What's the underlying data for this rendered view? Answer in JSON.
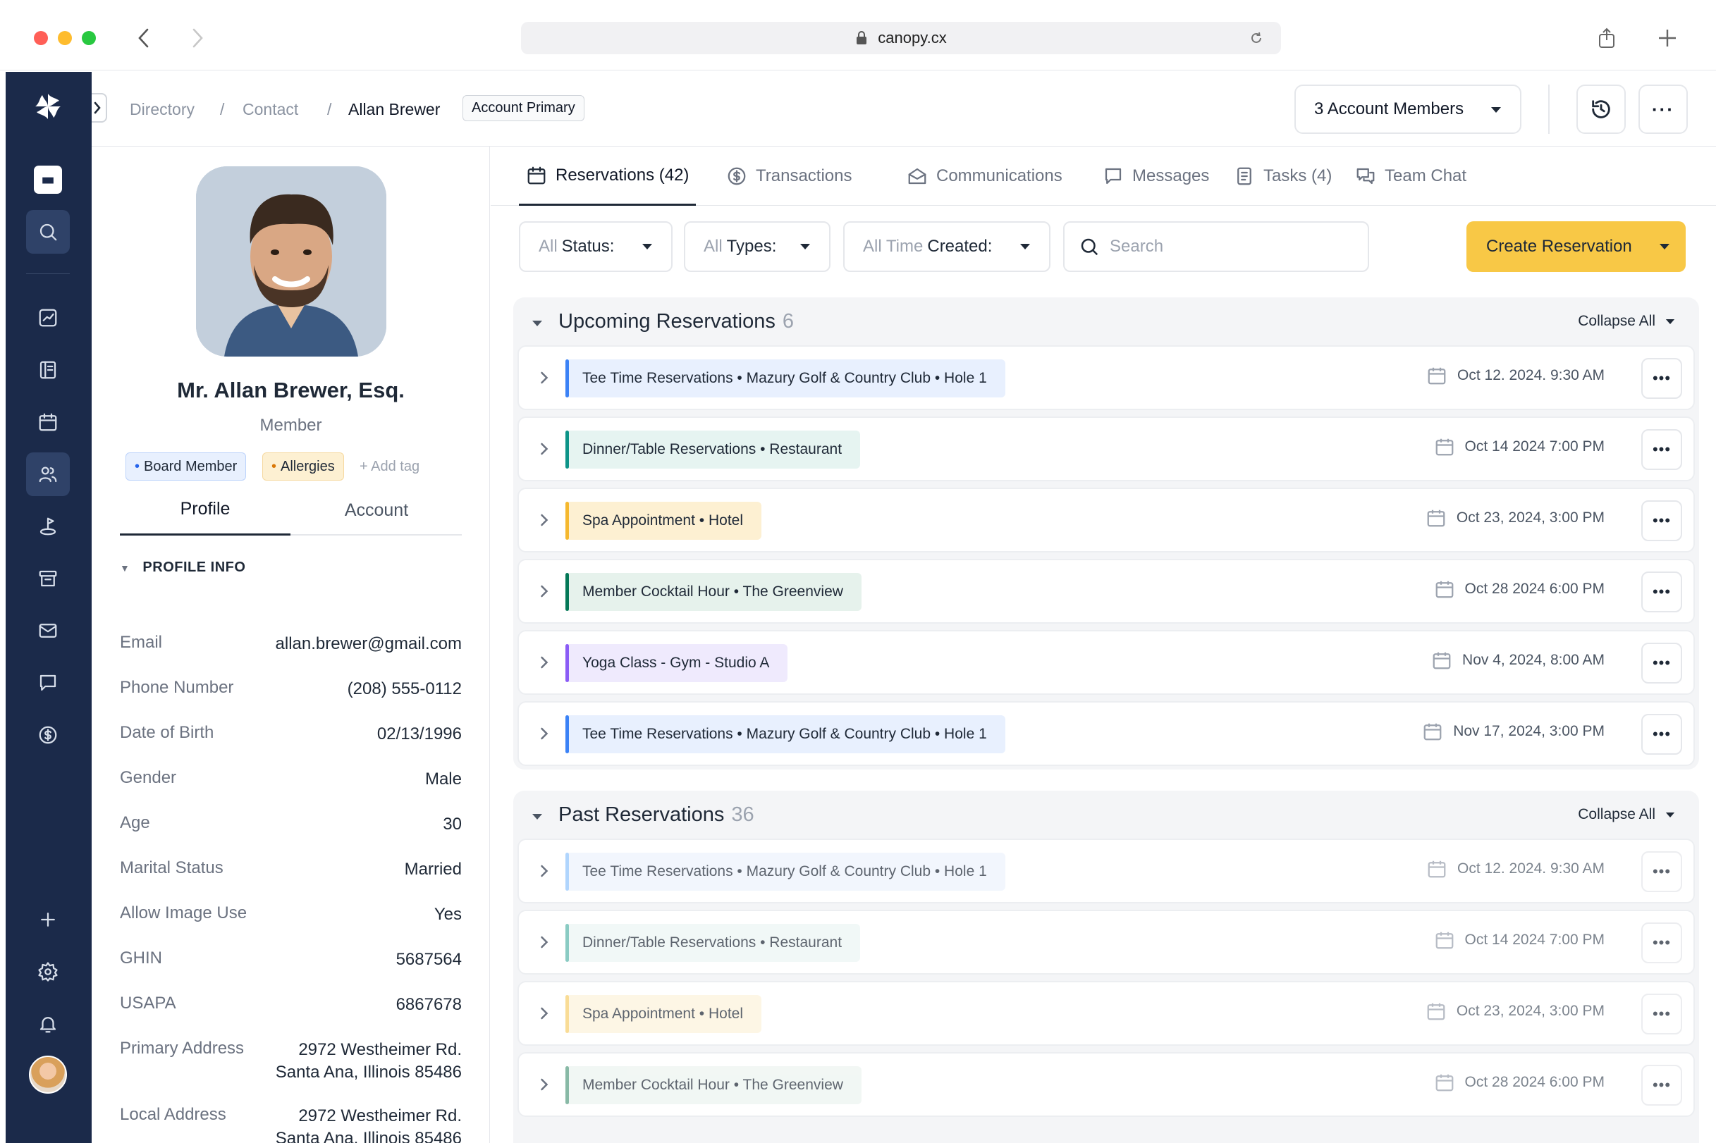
{
  "browser": {
    "url": "canopy.cx"
  },
  "breadcrumb": {
    "items": [
      "Directory",
      "Contact"
    ],
    "current": "Allan Brewer",
    "badge": "Account Primary"
  },
  "header": {
    "members_label": "3 Account Members"
  },
  "profile": {
    "name": "Mr. Allan Brewer, Esq.",
    "role": "Member",
    "tags": [
      {
        "label": "Board Member",
        "color": "#2563eb"
      },
      {
        "label": "Allergies",
        "color": "#d97706"
      }
    ],
    "add_tag": "+ Add tag",
    "tabs": [
      "Profile",
      "Account"
    ],
    "section_title": "PROFILE INFO",
    "fields": [
      {
        "label": "Email",
        "value": "allan.brewer@gmail.com"
      },
      {
        "label": "Phone Number",
        "value": "(208) 555-0112"
      },
      {
        "label": "Date of Birth",
        "value": "02/13/1996"
      },
      {
        "label": "Gender",
        "value": "Male"
      },
      {
        "label": "Age",
        "value": "30"
      },
      {
        "label": "Marital Status",
        "value": "Married"
      },
      {
        "label": "Allow Image Use",
        "value": "Yes"
      },
      {
        "label": "GHIN",
        "value": "5687564"
      },
      {
        "label": "USAPA",
        "value": "6867678"
      },
      {
        "label": "Primary Address",
        "value": "2972 Westheimer Rd.",
        "value2": "Santa Ana, Illinois 85486"
      },
      {
        "label": "Local Address",
        "value": "2972 Westheimer Rd.",
        "value2": "Santa Ana, Illinois 85486"
      }
    ]
  },
  "tabs": [
    {
      "label": "Reservations (42)",
      "icon": "calendar-icon"
    },
    {
      "label": "Transactions",
      "icon": "dollar-circle-icon"
    },
    {
      "label": "Communications",
      "icon": "envelope-open-icon"
    },
    {
      "label": "Messages",
      "icon": "chat-bubble-icon"
    },
    {
      "label": "Tasks (4)",
      "icon": "clipboard-icon"
    },
    {
      "label": "Team Chat",
      "icon": "team-chat-icon"
    }
  ],
  "filters": {
    "status": {
      "muted": "All",
      "label": "Status:"
    },
    "types": {
      "muted": "All",
      "label": "Types:"
    },
    "time": {
      "muted": "All Time",
      "label": "Created:"
    },
    "search_placeholder": "Search",
    "create_label": "Create Reservation"
  },
  "upcoming": {
    "title": "Upcoming Reservations",
    "count": "6",
    "collapse_label": "Collapse All",
    "rows": [
      {
        "title": "Tee Time Reservations  •  Mazury Golf & Country Club  •  Hole 1",
        "date": "Oct 12. 2024. 9:30 AM",
        "bar": "#3b82f6",
        "bg": "#e8f0fe"
      },
      {
        "title": "Dinner/Table Reservations  •  Restaurant",
        "date": "Oct 14 2024 7:00 PM",
        "bar": "#0d9488",
        "bg": "#e6f4f1"
      },
      {
        "title": "Spa Appointment • Hotel",
        "date": "Oct 23, 2024, 3:00 PM",
        "bar": "#f5b82e",
        "bg": "#fdf0d2"
      },
      {
        "title": "Member Cocktail Hour  •  The Greenview",
        "date": "Oct 28 2024 6:00 PM",
        "bar": "#047857",
        "bg": "#e6f2ec"
      },
      {
        "title": "Yoga Class - Gym - Studio A",
        "date": "Nov 4, 2024, 8:00 AM",
        "bar": "#8b5cf6",
        "bg": "#efeafd"
      },
      {
        "title": "Tee Time Reservations  •  Mazury Golf & Country Club  •  Hole 1",
        "date": "Nov 17, 2024, 3:00 PM",
        "bar": "#3b82f6",
        "bg": "#e8f0fe"
      }
    ]
  },
  "past": {
    "title": "Past Reservations",
    "count": "36",
    "collapse_label": "Collapse All",
    "rows": [
      {
        "title": "Tee Time Reservations  •  Mazury Golf & Country Club  •  Hole 1",
        "date": "Oct 12. 2024. 9:30 AM",
        "bar": "#93c5fd",
        "bg": "#eef3fd"
      },
      {
        "title": "Dinner/Table Reservations  •  Restaurant",
        "date": "Oct 14 2024 7:00 PM",
        "bar": "#5eb8ad",
        "bg": "#edf6f4"
      },
      {
        "title": "Spa Appointment • Hotel",
        "date": "Oct 23, 2024, 3:00 PM",
        "bar": "#f7cf6e",
        "bg": "#fdf3dc"
      },
      {
        "title": "Member Cocktail Hour  •  The Greenview",
        "date": "Oct 28 2024 6:00 PM",
        "bar": "#5b9f84",
        "bg": "#edf4f0"
      }
    ]
  }
}
